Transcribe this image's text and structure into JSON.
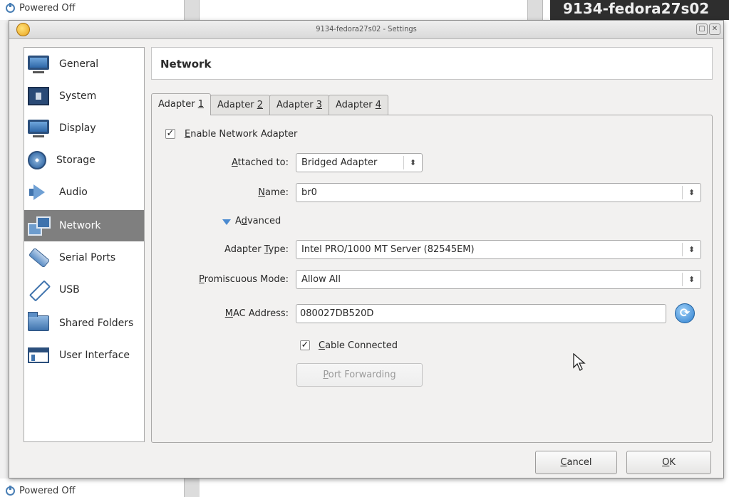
{
  "background": {
    "top_status": "Powered Off",
    "top_right_vm_name": "9134-fedora27s02",
    "bottom_status": "Powered Off"
  },
  "window": {
    "title": "9134-fedora27s02 - Settings"
  },
  "sidebar": {
    "items": [
      {
        "label": "General",
        "icon": "monitor-icon"
      },
      {
        "label": "System",
        "icon": "chip-icon"
      },
      {
        "label": "Display",
        "icon": "display-icon"
      },
      {
        "label": "Storage",
        "icon": "disk-icon"
      },
      {
        "label": "Audio",
        "icon": "speaker-icon"
      },
      {
        "label": "Network",
        "icon": "network-icon",
        "selected": true
      },
      {
        "label": "Serial Ports",
        "icon": "serial-port-icon"
      },
      {
        "label": "USB",
        "icon": "usb-icon"
      },
      {
        "label": "Shared Folders",
        "icon": "folder-icon"
      },
      {
        "label": "User Interface",
        "icon": "user-interface-icon"
      }
    ]
  },
  "header": {
    "title": "Network"
  },
  "tabs": [
    {
      "prefix": "Adapter ",
      "accel": "1",
      "active": true
    },
    {
      "prefix": "Adapter ",
      "accel": "2"
    },
    {
      "prefix": "Adapter ",
      "accel": "3"
    },
    {
      "prefix": "Adapter ",
      "accel": "4"
    }
  ],
  "form": {
    "enable_adapter": {
      "accel": "E",
      "rest": "nable Network Adapter",
      "checked": true
    },
    "attached_to": {
      "accel": "A",
      "rest": "ttached to:",
      "value": "Bridged Adapter"
    },
    "name": {
      "pre": "",
      "accel": "N",
      "rest": "ame:",
      "value": "br0"
    },
    "advanced": {
      "pre": "A",
      "accel": "d",
      "rest": "vanced"
    },
    "adapter_type": {
      "pre": "Adapter ",
      "accel": "T",
      "rest": "ype:",
      "value": "Intel PRO/1000 MT Server (82545EM)"
    },
    "promiscuous_mode": {
      "accel": "P",
      "rest": "romiscuous Mode:",
      "value": "Allow All"
    },
    "mac_address": {
      "accel": "M",
      "rest": "AC Address:",
      "value": "080027DB520D"
    },
    "cable_connected": {
      "accel": "C",
      "rest": "able Connected",
      "checked": true
    },
    "port_forwarding": {
      "accel": "P",
      "rest": "ort Forwarding"
    }
  },
  "buttons": {
    "cancel": {
      "accel": "C",
      "rest": "ancel"
    },
    "ok": {
      "accel": "O",
      "rest": "K"
    }
  }
}
